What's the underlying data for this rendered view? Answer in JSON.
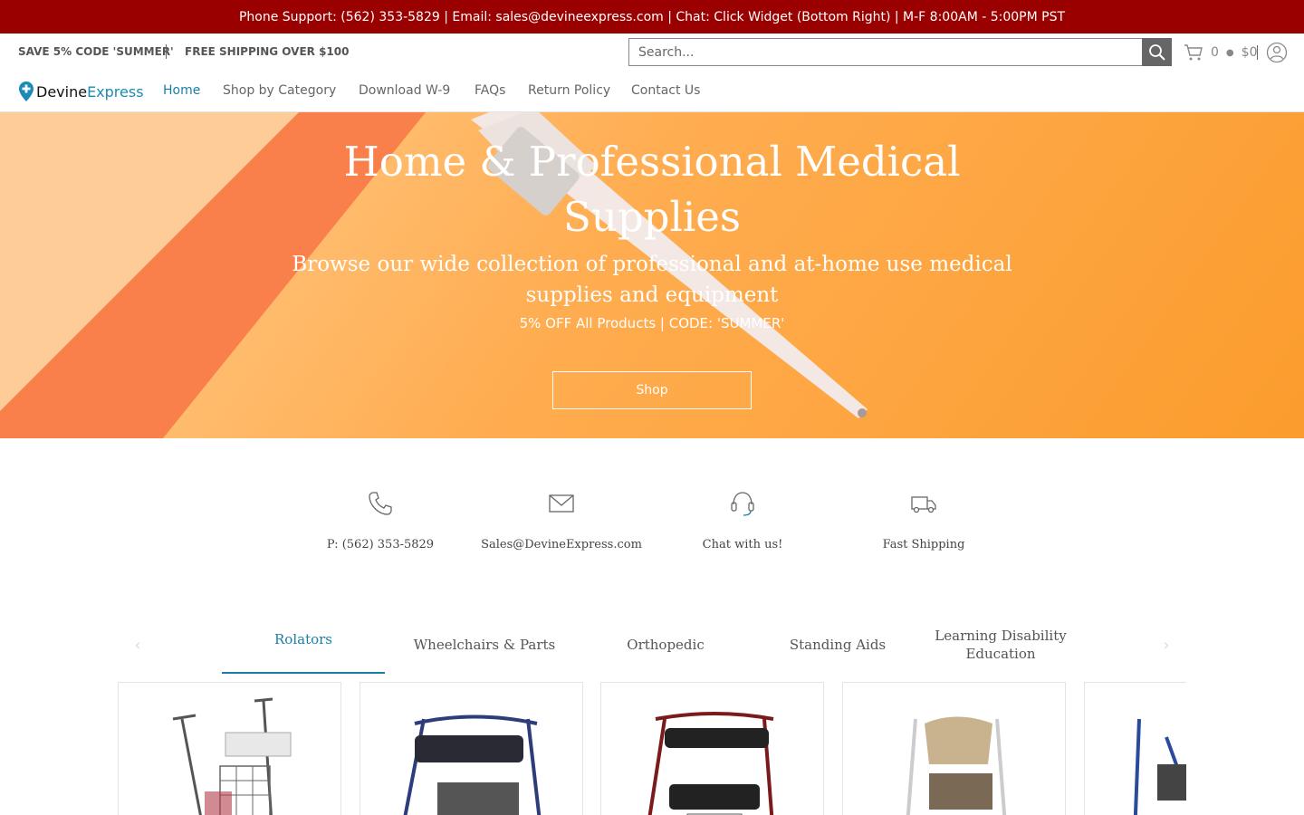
{
  "announcement": "Phone Support: (562) 353-5829 | Email: sales@devineexpress.com | Chat: Click Widget (Bottom Right) | M-F 8:00AM - 5:00PM PST",
  "utility": {
    "promo_code": "SAVE 5% CODE 'SUMMER'",
    "free_shipping": "FREE SHIPPING OVER $100",
    "search_placeholder": "Search...",
    "cart_count": "0",
    "cart_total": "$0"
  },
  "logo": {
    "part1": "Devine",
    "part2": "Express"
  },
  "nav": [
    {
      "label": "Home",
      "active": true
    },
    {
      "label": "Shop by Category"
    },
    {
      "label": "Download W-9"
    },
    {
      "label": "FAQs"
    },
    {
      "label": "Return Policy"
    },
    {
      "label": "Contact Us"
    }
  ],
  "hero": {
    "title": "Home & Professional Medical Supplies",
    "subtitle": "Browse our wide collection of professional and at-home use medical supplies and equipment",
    "promo": "5% OFF All Products | CODE: 'SUMMER'",
    "button": "Shop"
  },
  "features": [
    {
      "icon": "phone-icon",
      "label": "P: (562) 353-5829"
    },
    {
      "icon": "mail-icon",
      "label": "Sales@DevineExpress.com"
    },
    {
      "icon": "headset-icon",
      "label": "Chat with us!"
    },
    {
      "icon": "truck-icon",
      "label": "Fast Shipping"
    }
  ],
  "tabs": [
    {
      "label": "Rolators",
      "active": true
    },
    {
      "label": "Wheelchairs & Parts"
    },
    {
      "label": "Orthopedic"
    },
    {
      "label": "Standing Aids"
    },
    {
      "label": "Learning Disability Education"
    }
  ],
  "colors": {
    "announcement_bg": "#9b0000",
    "accent": "#1a7fa8",
    "hero_orange": "#fb9c2d"
  }
}
